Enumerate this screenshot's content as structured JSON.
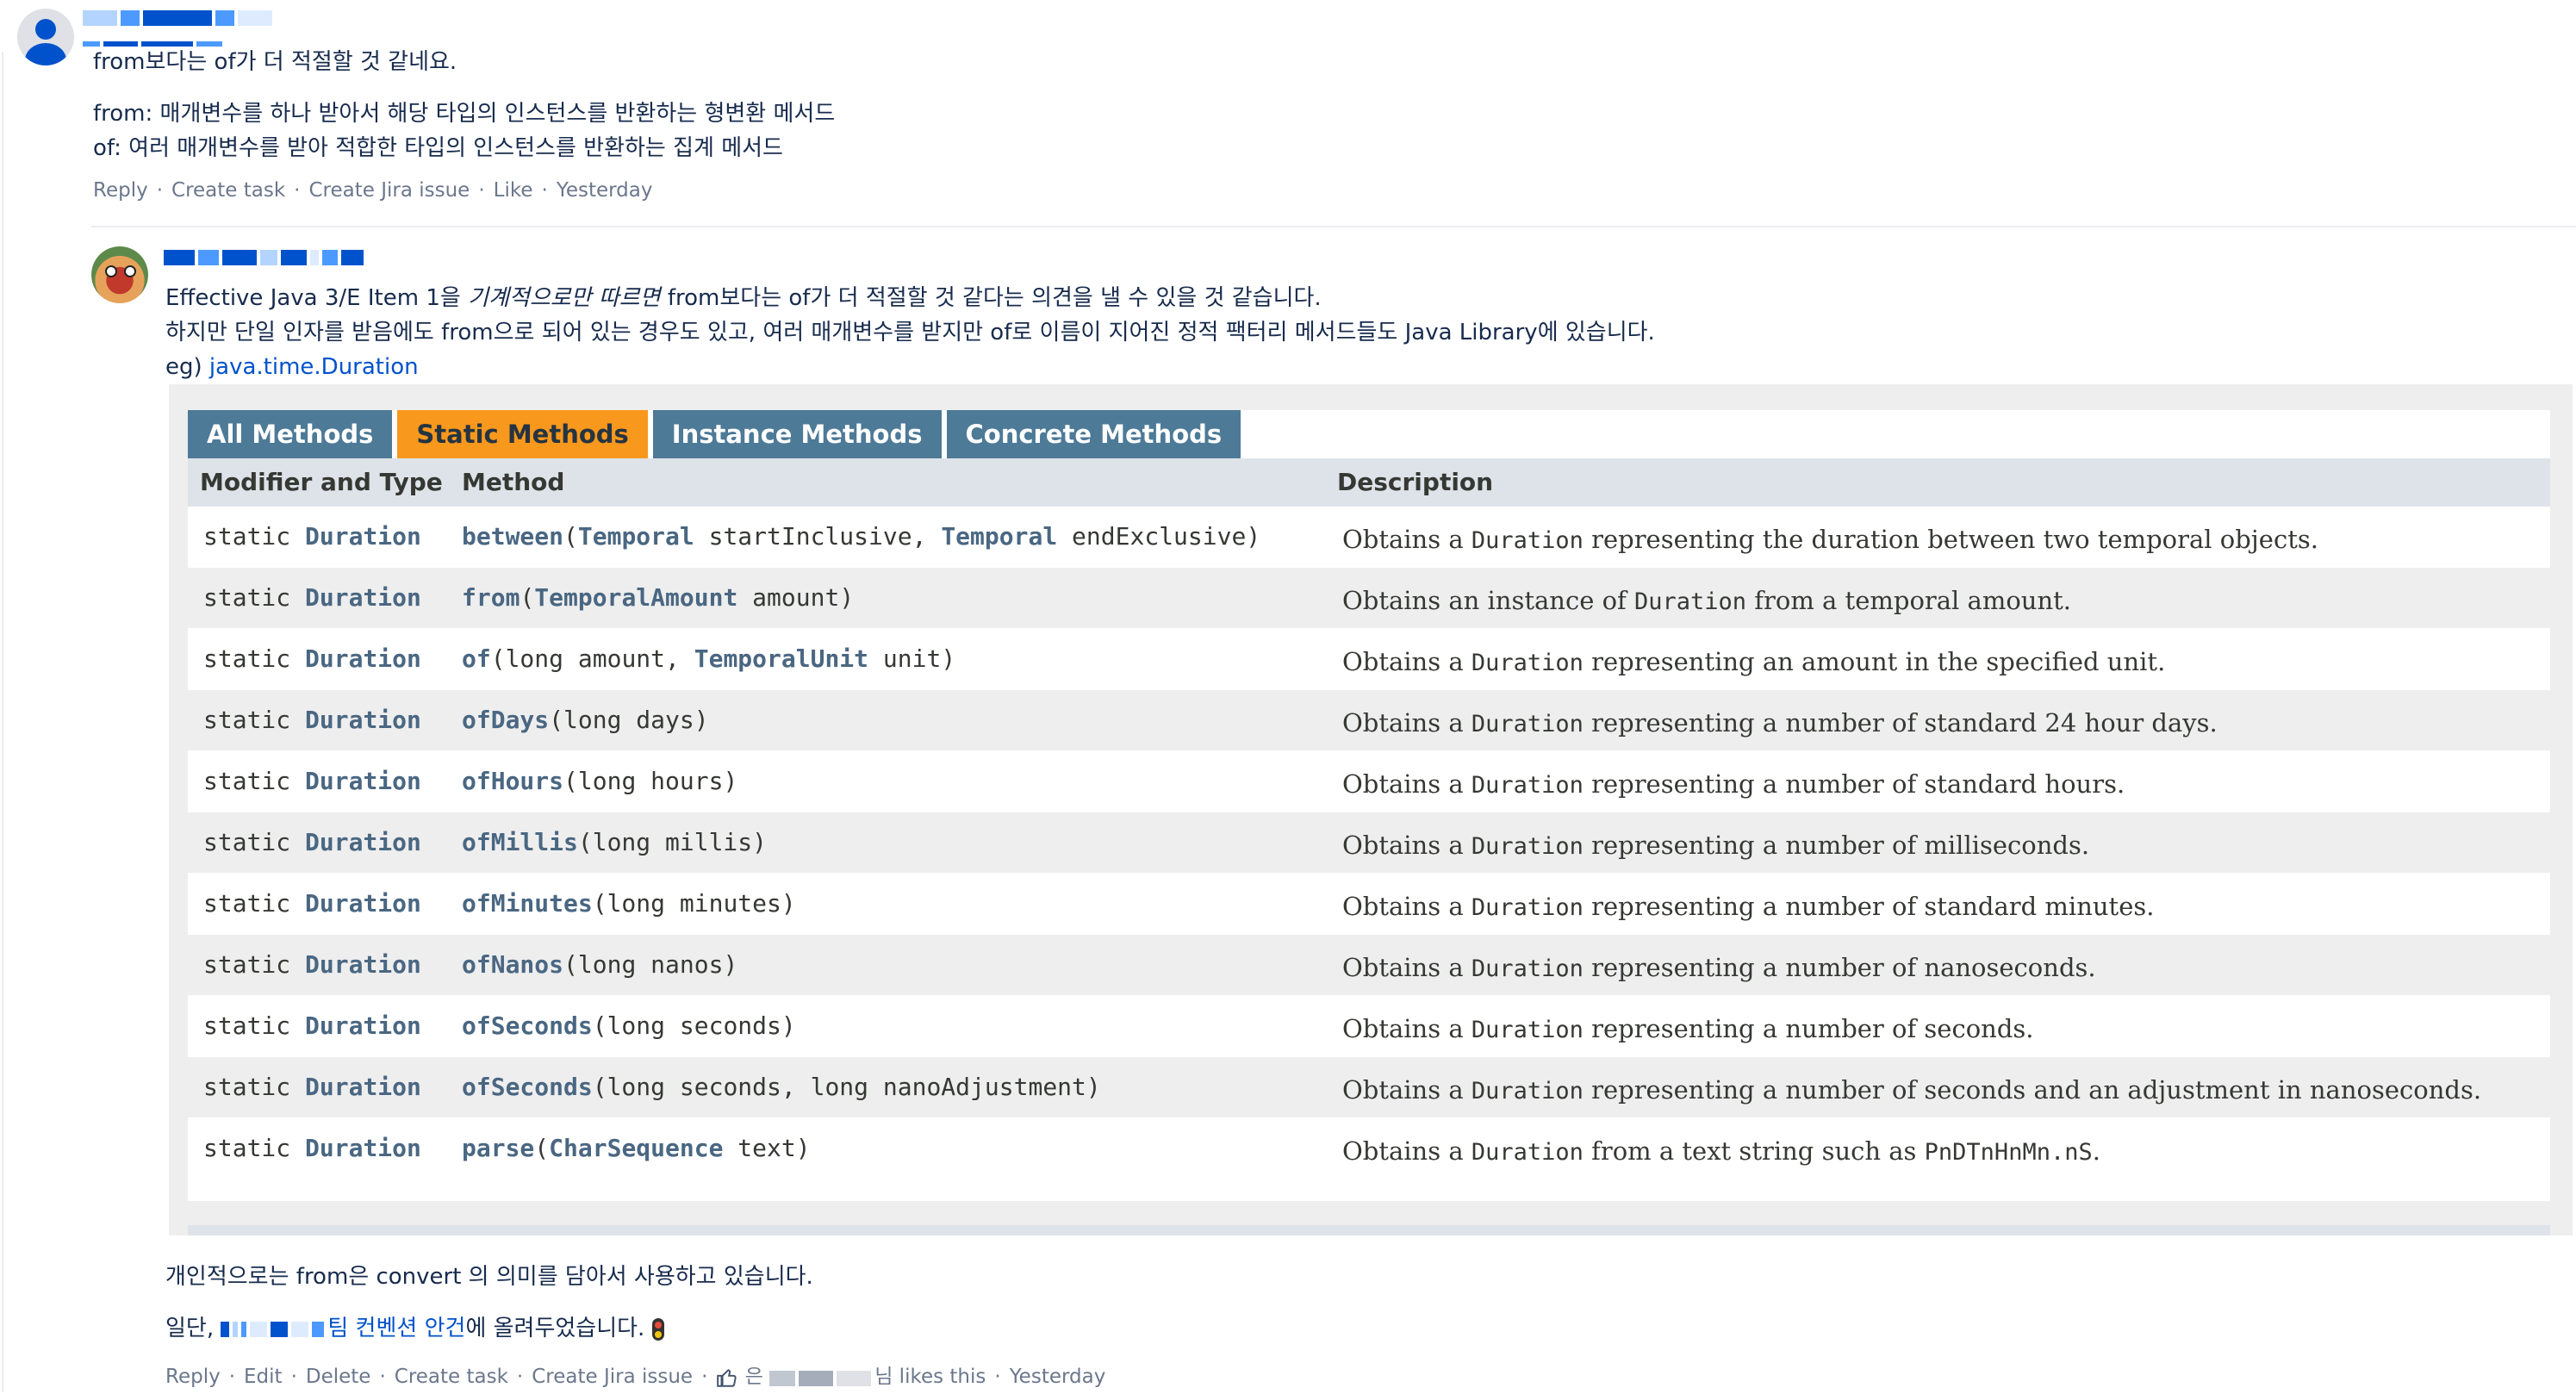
{
  "comment1": {
    "line1": "from보다는 of가 더 적절할 것 같네요.",
    "line2": "from: 매개변수를 하나 받아서 해당 타입의 인스턴스를 반환하는 형변환 메서드",
    "line3": "of: 여러 매개변수를 받아 적합한 타입의 인스턴스를 반환하는 집계 메서드",
    "actions": [
      "Reply",
      "Create task",
      "Create Jira issue",
      "Like",
      "Yesterday"
    ]
  },
  "comment2": {
    "line1_a": "Effective Java 3/E Item 1을 ",
    "line1_em": "기계적으로만 따르면",
    "line1_b": " from보다는 of가 더 적절할 것 같다는 의견을 낼 수 있을 것 같습니다.",
    "line2": "하지만 단일 인자를 받음에도 from으로 되어 있는 경우도 있고, 여러 매개변수를 받지만 of로 이름이 지어진 정적 팩터리 메서드들도 Java Library에 있습니다.",
    "line3_prefix": "eg) ",
    "line3_link": "java.time.Duration",
    "after1": "개인적으로는 from은 convert 의 의미를 담아서 사용하고 있습니다.",
    "after2_prefix": "일단, ",
    "after2_link": "팀 컨벤션 안건",
    "after2_suffix": "에 올려두었습니다.",
    "actions": [
      "Reply",
      "Edit",
      "Delete",
      "Create task",
      "Create Jira issue"
    ],
    "likes_prefix": "은",
    "likes_suffix": "님 likes this",
    "timestamp": "Yesterday"
  },
  "javadoc": {
    "tabs": [
      "All Methods",
      "Static Methods",
      "Instance Methods",
      "Concrete Methods"
    ],
    "active_tab": "Static Methods",
    "headers": [
      "Modifier and Type",
      "Method",
      "Description"
    ],
    "rows": [
      {
        "mod": "static",
        "type": "Duration",
        "name": "between",
        "params": [
          [
            "Temporal",
            " startInclusive"
          ],
          [
            "Temporal",
            " endExclusive"
          ]
        ],
        "desc_pre": "Obtains a ",
        "desc_code": "Duration",
        "desc_post": " representing the duration between two temporal objects."
      },
      {
        "mod": "static",
        "type": "Duration",
        "name": "from",
        "params": [
          [
            "TemporalAmount",
            " amount"
          ]
        ],
        "desc_pre": "Obtains an instance of ",
        "desc_code": "Duration",
        "desc_post": " from a temporal amount."
      },
      {
        "mod": "static",
        "type": "Duration",
        "name": "of",
        "params": [
          [
            "",
            "long amount"
          ],
          [
            "TemporalUnit",
            " unit"
          ]
        ],
        "desc_pre": "Obtains a ",
        "desc_code": "Duration",
        "desc_post": " representing an amount in the specified unit."
      },
      {
        "mod": "static",
        "type": "Duration",
        "name": "ofDays",
        "params": [
          [
            "",
            "long days"
          ]
        ],
        "desc_pre": "Obtains a ",
        "desc_code": "Duration",
        "desc_post": " representing a number of standard 24 hour days."
      },
      {
        "mod": "static",
        "type": "Duration",
        "name": "ofHours",
        "params": [
          [
            "",
            "long hours"
          ]
        ],
        "desc_pre": "Obtains a ",
        "desc_code": "Duration",
        "desc_post": " representing a number of standard hours."
      },
      {
        "mod": "static",
        "type": "Duration",
        "name": "ofMillis",
        "params": [
          [
            "",
            "long millis"
          ]
        ],
        "desc_pre": "Obtains a ",
        "desc_code": "Duration",
        "desc_post": " representing a number of milliseconds."
      },
      {
        "mod": "static",
        "type": "Duration",
        "name": "ofMinutes",
        "params": [
          [
            "",
            "long minutes"
          ]
        ],
        "desc_pre": "Obtains a ",
        "desc_code": "Duration",
        "desc_post": " representing a number of standard minutes."
      },
      {
        "mod": "static",
        "type": "Duration",
        "name": "ofNanos",
        "params": [
          [
            "",
            "long nanos"
          ]
        ],
        "desc_pre": "Obtains a ",
        "desc_code": "Duration",
        "desc_post": " representing a number of nanoseconds."
      },
      {
        "mod": "static",
        "type": "Duration",
        "name": "ofSeconds",
        "params": [
          [
            "",
            "long seconds"
          ]
        ],
        "desc_pre": "Obtains a ",
        "desc_code": "Duration",
        "desc_post": " representing a number of seconds."
      },
      {
        "mod": "static",
        "type": "Duration",
        "name": "ofSeconds",
        "params": [
          [
            "",
            "long seconds"
          ],
          [
            "",
            "long nanoAdjustment"
          ]
        ],
        "desc_pre": "Obtains a ",
        "desc_code": "Duration",
        "desc_post": " representing a number of seconds and an adjustment in nanoseconds."
      },
      {
        "mod": "static",
        "type": "Duration",
        "name": "parse",
        "params": [
          [
            "CharSequence",
            " text"
          ]
        ],
        "desc_pre": "Obtains a ",
        "desc_code": "Duration",
        "desc_post": " from a text string such as ",
        "desc_code2": "PnDTnHnMn.nS",
        "desc_end": "."
      }
    ]
  },
  "icons": {
    "avatar1": "default-user-avatar-icon",
    "avatar2": "cartoon-creature-avatar-icon",
    "emoji": "traffic-light-icon",
    "like": "thumbs-up-icon"
  }
}
